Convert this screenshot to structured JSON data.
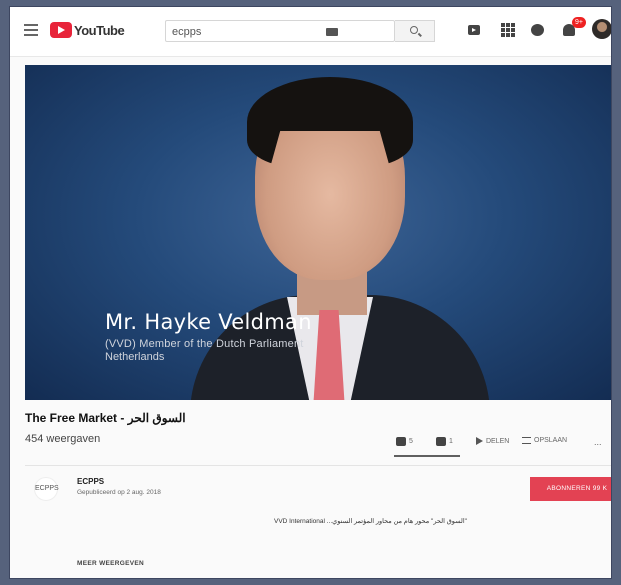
{
  "app": {
    "name": "YouTube"
  },
  "header": {
    "logo_text": "YouTube",
    "search_value": "ecpps",
    "notification_count": "9+"
  },
  "video": {
    "lower_third_name": "Mr. Hayke Veldman",
    "lower_third_role": "(VVD) Member of the Dutch Parliament",
    "lower_third_country": "Netherlands"
  },
  "info": {
    "title": "The Free Market - السوق الحر",
    "views": "454 weergaven",
    "likes": "5",
    "dislikes": "1",
    "share_label": "DELEN",
    "save_label": "OPSLAAN",
    "more_label": "..."
  },
  "channel": {
    "avatar_text": "ECPPS",
    "name": "ECPPS",
    "published": "Gepubliceerd op 2 aug. 2018",
    "subscribe_label": "ABONNEREN 99 K",
    "description": "\"السوق الحر\" محور هام من محاور المؤتمر السنوي... VVD International",
    "show_more": "MEER WEERGEVEN"
  },
  "colors": {
    "accent": "#e8243a",
    "subscribe": "#e34253",
    "video_bg": "#244a7a"
  }
}
